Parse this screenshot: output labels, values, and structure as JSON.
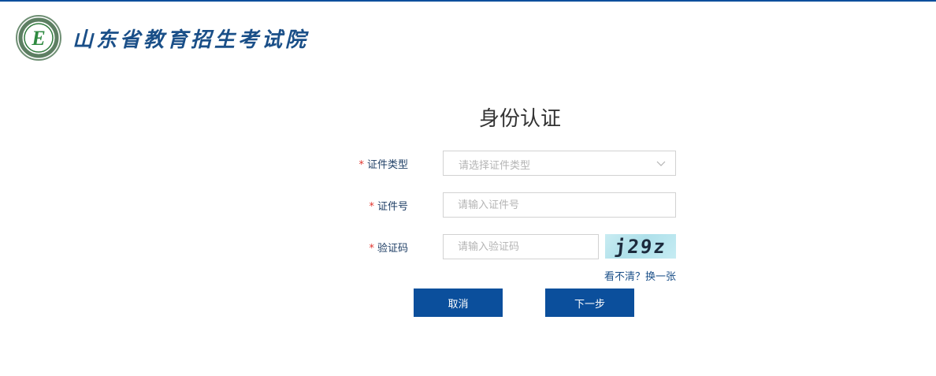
{
  "header": {
    "site_name": "山东省教育招生考试院",
    "logo_letter": "E"
  },
  "page": {
    "title": "身份认证"
  },
  "form": {
    "required_mark": "*",
    "id_type": {
      "label": "证件类型",
      "placeholder": "请选择证件类型"
    },
    "id_number": {
      "label": "证件号",
      "placeholder": "请输入证件号"
    },
    "captcha": {
      "label": "验证码",
      "placeholder": "请输入验证码",
      "image_text": "j29z",
      "refresh_text": "看不清？换一张"
    }
  },
  "buttons": {
    "cancel": "取消",
    "next": "下一步"
  },
  "colors": {
    "brand": "#0b4f9c",
    "required": "#e0342c",
    "captcha_bg": "#aee0ea"
  },
  "icons": {
    "select": "chevron-down-icon",
    "logo": "emblem-logo-icon"
  }
}
